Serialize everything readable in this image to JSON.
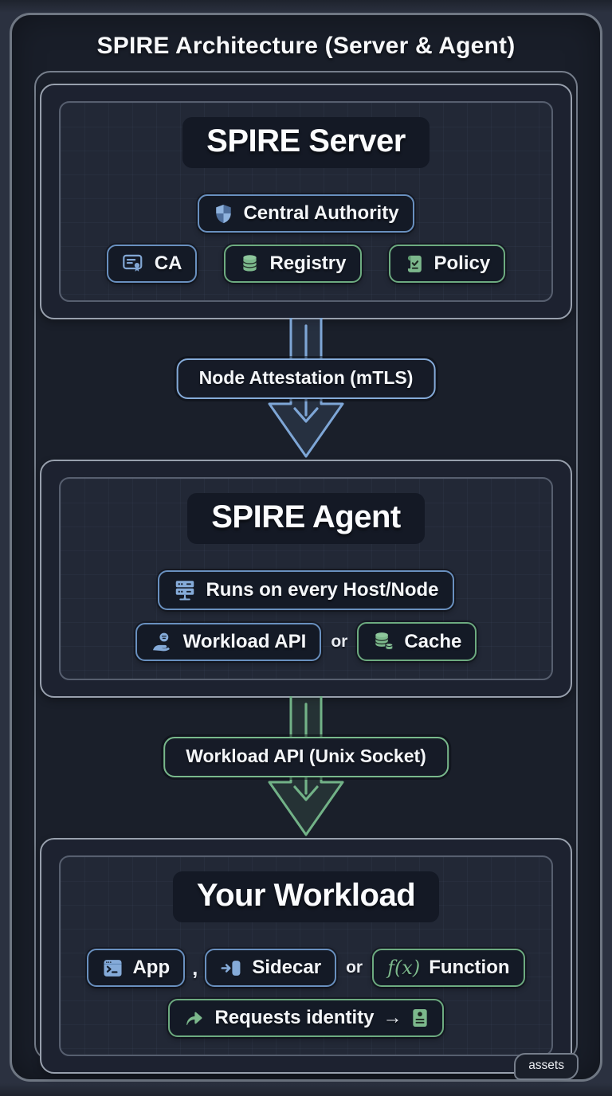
{
  "page": {
    "title": "SPIRE Architecture (Server & Agent)",
    "assets_label": "assets"
  },
  "colors": {
    "blue_accent": "#7ea6d6",
    "green_accent": "#79b88b",
    "background": "#2b3140",
    "panel": "#1a1f2a",
    "badge_bg": "#141a26",
    "text": "#f5f7fa"
  },
  "sections": {
    "server": {
      "title": "SPIRE Server",
      "badge_central": "Central Authority",
      "badge_ca": "CA",
      "badge_registry": "Registry",
      "badge_policy": "Policy"
    },
    "agent": {
      "title": "SPIRE Agent",
      "badge_runs": "Runs on every Host/Node",
      "badge_workload_api": "Workload API",
      "or_label": "or",
      "badge_cache": "Cache"
    },
    "workload": {
      "title": "Your Workload",
      "badge_app": "App",
      "comma_label": ",",
      "badge_sidecar": "Sidecar",
      "or_label": "or",
      "badge_function": "Function",
      "function_icon_text": "f(x)",
      "badge_requests": "Requests identity",
      "requests_arrow_glyph": "→"
    }
  },
  "arrows": {
    "node_attestation": {
      "label": "Node Attestation (mTLS)",
      "color": "#7ea6d6"
    },
    "workload_api": {
      "label": "Workload API (Unix Socket)",
      "color": "#72b287"
    }
  },
  "icons": {
    "central_authority": "shield-icon",
    "ca": "certificate-icon",
    "registry": "database-icon",
    "policy": "policy-scroll-icon",
    "runs": "server-rack-icon",
    "workload_api": "hand-identity-icon",
    "cache": "coin-stack-icon",
    "app": "terminal-icon",
    "sidecar": "arrow-into-box-icon",
    "function": "fx-icon",
    "requests": "share-arrow-icon",
    "identity_card": "id-badge-icon"
  }
}
